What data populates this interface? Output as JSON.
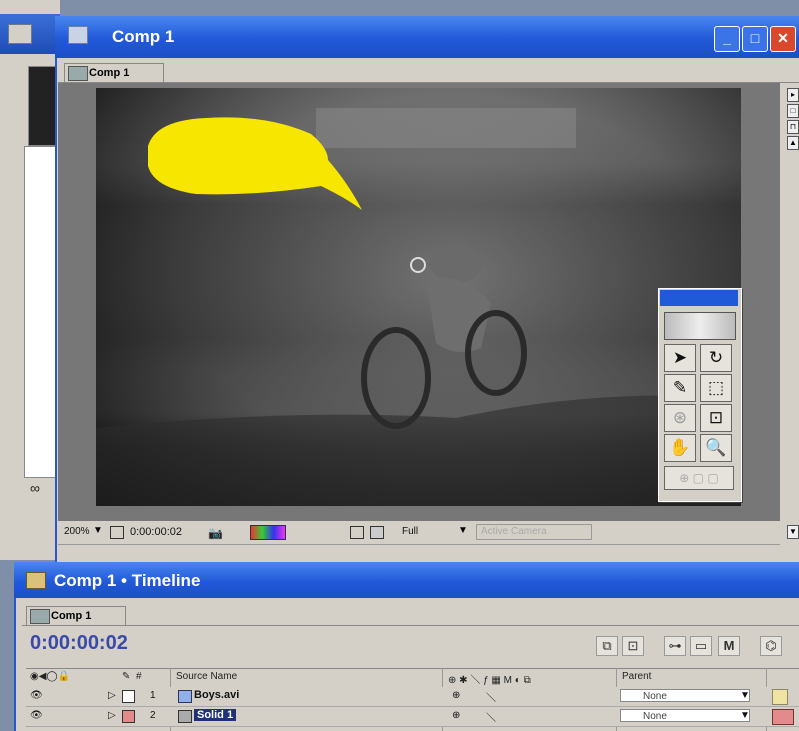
{
  "comp_window": {
    "title": "Comp 1",
    "tab_label": "Comp 1",
    "min_glyph": "_",
    "max_glyph": "□",
    "close_glyph": "✕"
  },
  "viewer_bar": {
    "zoom": "200%",
    "timecode": "0:00:00:02",
    "resolution": "Full",
    "camera": "Active Camera"
  },
  "timeline": {
    "title": "Comp 1 • Timeline",
    "tab_label": "Comp 1",
    "current_time": "0:00:00:02",
    "columns": {
      "number": "#",
      "source_name": "Source Name",
      "parent": "Parent"
    },
    "layers": [
      {
        "number": "1",
        "name": "Boys.avi",
        "parent": "None",
        "label_color": "#ffffff"
      },
      {
        "number": "2",
        "name": "Solid 1",
        "parent": "None",
        "label_color": "#e38a8a"
      }
    ]
  },
  "icons": {
    "eye": "👁",
    "pen": "✎",
    "arrow": "➤",
    "hand": "✋",
    "zoom": "🔍",
    "rotate": "↻"
  },
  "colors": {
    "titlebar": "#2159d8",
    "mask_fill": "#f7e600",
    "timecode": "#3a4aa8"
  }
}
